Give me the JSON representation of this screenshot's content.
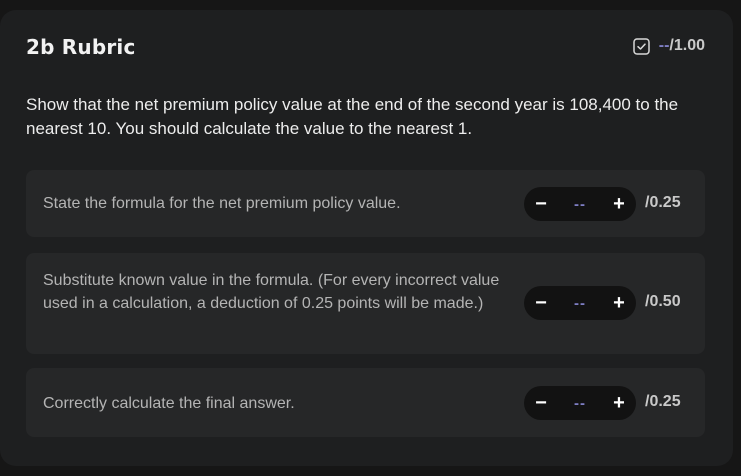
{
  "rubric": {
    "title": "2b Rubric",
    "total": {
      "score": "--",
      "max": "/1.00",
      "icon": "checkbox-icon"
    },
    "question": "Show that the net premium policy value at the end of the second year is 108,400 to the nearest 10. You should calculate the value to the nearest 1.",
    "items": [
      {
        "text": "State the formula for the net premium policy value.",
        "minus": "−",
        "value": "--",
        "plus": "+",
        "max": "/0.25"
      },
      {
        "text": "Substitute known value in the formula. (For every incorrect value used in a calculation, a deduction of 0.25 points will be made.)",
        "minus": "−",
        "value": "--",
        "plus": "+",
        "max": "/0.50"
      },
      {
        "text": "Correctly calculate the final answer.",
        "minus": "−",
        "value": "--",
        "plus": "+",
        "max": "/0.25"
      }
    ]
  },
  "colors": {
    "background": "#161616",
    "card": "#1e1f20",
    "item": "#262728",
    "stepper": "#121212",
    "accent": "#7f7fc4"
  }
}
